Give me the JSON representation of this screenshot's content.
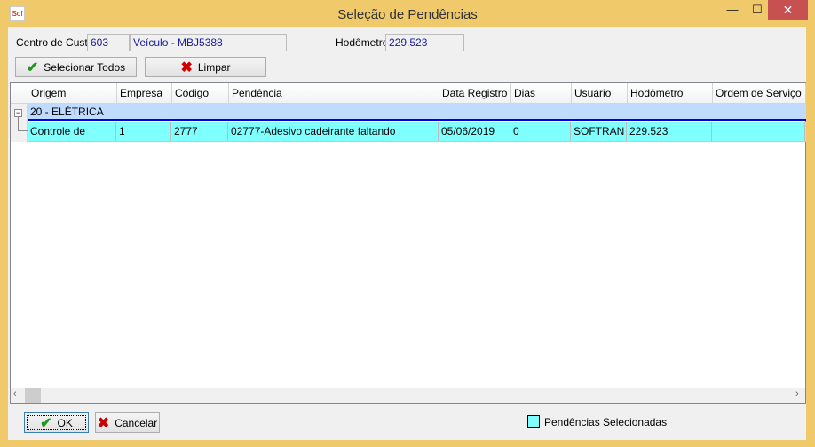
{
  "window": {
    "title": "Seleção de Pendências",
    "logo_text": "Sof",
    "minimize": "—",
    "maximize": "☐",
    "close": "✕"
  },
  "form": {
    "centro_custo_label": "Centro de Custo",
    "centro_custo_value": "603",
    "veiculo_value": "Veículo - MBJ5388",
    "hodometro_label": "Hodômetro",
    "hodometro_value": "229.523",
    "select_all_label": "Selecionar Todos",
    "clear_label": "Limpar"
  },
  "grid": {
    "columns": [
      "Origem",
      "Empresa",
      "Código",
      "Pendência",
      "Data Registro",
      "Dias",
      "Usuário",
      "Hodômetro",
      "Ordem de Serviço"
    ],
    "group": {
      "label": "20 - ELÉTRICA",
      "expanded": true
    },
    "rows": [
      [
        "Controle de",
        "1",
        "2777",
        "02777-Adesivo cadeirante faltando",
        "05/06/2019",
        "0",
        "SOFTRAN",
        "229.523",
        ""
      ]
    ]
  },
  "footer": {
    "ok_label": "OK",
    "cancel_label": "Cancelar",
    "legend_label": "Pendências Selecionadas",
    "legend_color": "#80ffff"
  },
  "colors": {
    "selected_row": "#80ffff",
    "group_row": "#bfdbff",
    "window_frame": "#f0c96a"
  }
}
